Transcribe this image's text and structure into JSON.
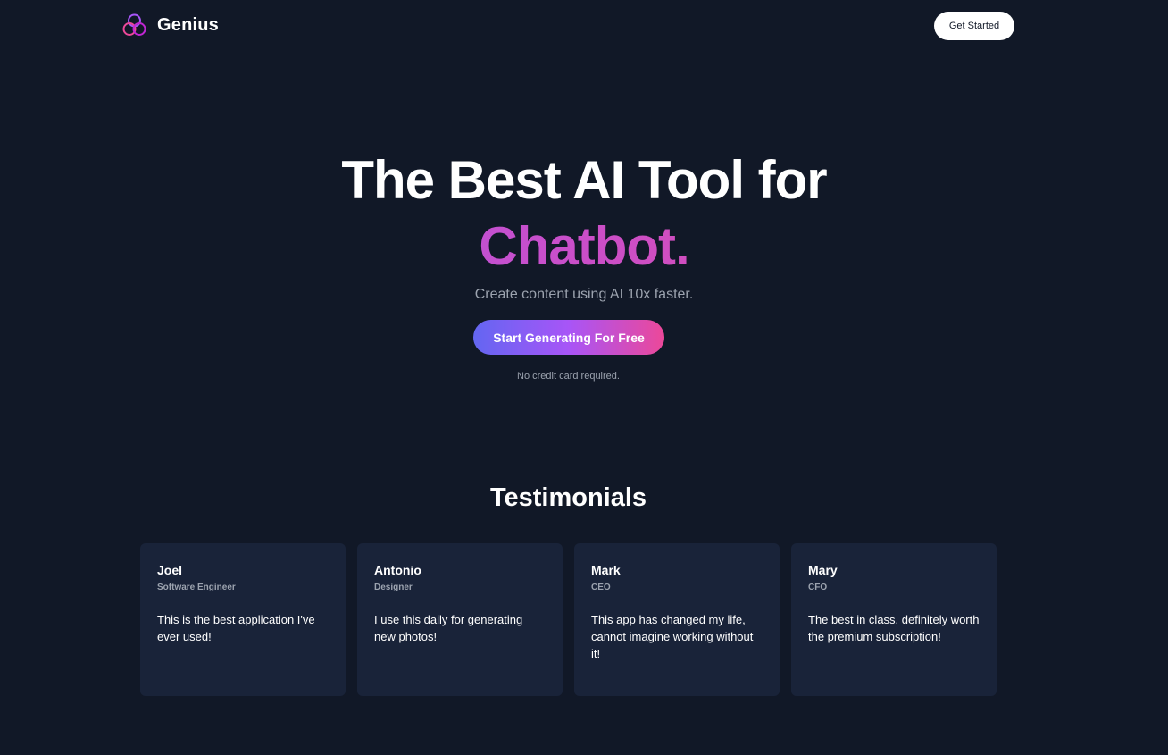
{
  "nav": {
    "brand": "Genius",
    "cta_label": "Get Started"
  },
  "hero": {
    "title_line1": "The Best AI Tool for",
    "title_line2": "Chatbot.",
    "subtitle": "Create content using AI 10x faster.",
    "cta_label": "Start Generating For Free",
    "note": "No credit card required."
  },
  "testimonials": {
    "title": "Testimonials",
    "items": [
      {
        "name": "Joel",
        "role": "Software Engineer",
        "text": "This is the best application I've ever used!"
      },
      {
        "name": "Antonio",
        "role": "Designer",
        "text": "I use this daily for generating new photos!"
      },
      {
        "name": "Mark",
        "role": "CEO",
        "text": "This app has changed my life, cannot imagine working without it!"
      },
      {
        "name": "Mary",
        "role": "CFO",
        "text": "The best in class, definitely worth the premium subscription!"
      }
    ]
  },
  "colors": {
    "background": "#111827",
    "card": "#192339",
    "accent_start": "#6366f1",
    "accent_mid": "#a855f7",
    "accent_end": "#ec4899",
    "muted_text": "#9ca3af"
  },
  "icons": {
    "logo": "three-rings-logo-icon"
  }
}
